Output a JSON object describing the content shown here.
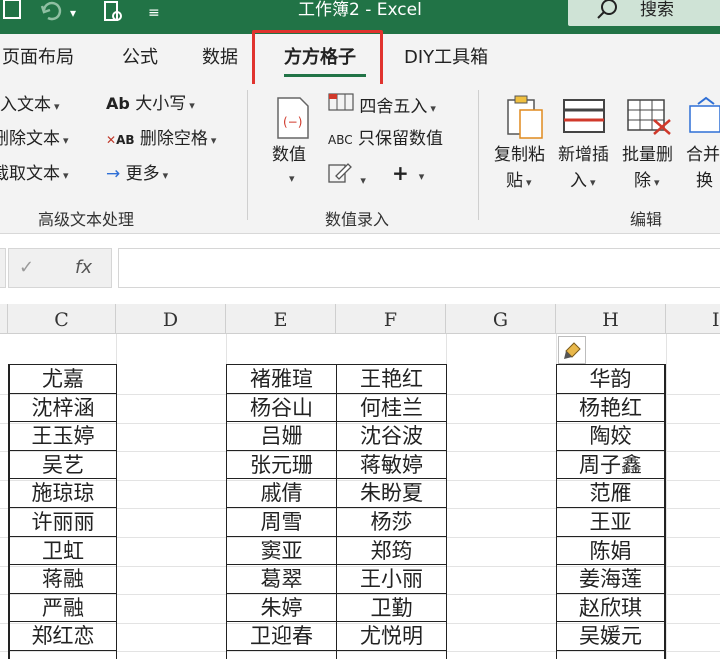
{
  "window": {
    "title": "工作簿2  -  Excel",
    "search_label": "搜索"
  },
  "tabs": [
    {
      "label": "页面布局",
      "active": false
    },
    {
      "label": "公式",
      "active": false
    },
    {
      "label": "数据",
      "active": false
    },
    {
      "label": "方方格子",
      "active": true
    },
    {
      "label": "DIY工具箱",
      "active": false
    }
  ],
  "ribbon": {
    "text_group": {
      "items": [
        "入文本",
        "删除文本",
        "截取文本"
      ],
      "case_label": "大小写",
      "case_icon_text": "Ab",
      "trim_label": "删除空格",
      "trim_icon_text": "AB",
      "more_label": "更多",
      "group_label": "高级文本处理"
    },
    "value_group": {
      "value_label": "数值",
      "round_label": "四舍五入",
      "keep_values_label": "只保留数值",
      "keep_values_icon_text": "ABC",
      "group_label": "数值录入"
    },
    "edit_group": {
      "copy_paste_label": [
        "复制粘",
        "贴"
      ],
      "insert_label": [
        "新增插",
        "入"
      ],
      "batch_delete_label": [
        "批量删",
        "除"
      ],
      "merge_label": [
        "合并",
        "换"
      ],
      "group_label": "编辑"
    }
  },
  "formula_bar": {
    "fx_label": "fx",
    "value": ""
  },
  "accent_colors": {
    "excel_green": "#217346",
    "highlight_red": "#e0332e"
  },
  "grid": {
    "columns": [
      "C",
      "D",
      "E",
      "F",
      "G",
      "H",
      "I"
    ],
    "col_c": [
      "尤嘉",
      "沈梓涵",
      "王玉婷",
      "吴艺",
      "施琼琼",
      "许丽丽",
      "卫虹",
      "蒋融",
      "严融",
      "郑红恋"
    ],
    "col_e": [
      "褚雅瑄",
      "杨谷山",
      "吕姗",
      "张元珊",
      "戚倩",
      "周雪",
      "窦亚",
      "葛翠",
      "朱婷",
      "卫迎春"
    ],
    "col_f": [
      "王艳红",
      "何桂兰",
      "沈谷波",
      "蒋敏婷",
      "朱盼夏",
      "杨莎",
      "郑筠",
      "王小丽",
      "卫勤",
      "尤悦明"
    ],
    "col_h": [
      "华韵",
      "杨艳红",
      "陶姣",
      "周子鑫",
      "范雁",
      "王亚",
      "陈娟",
      "姜海莲",
      "赵欣琪",
      "吴媛元"
    ]
  }
}
